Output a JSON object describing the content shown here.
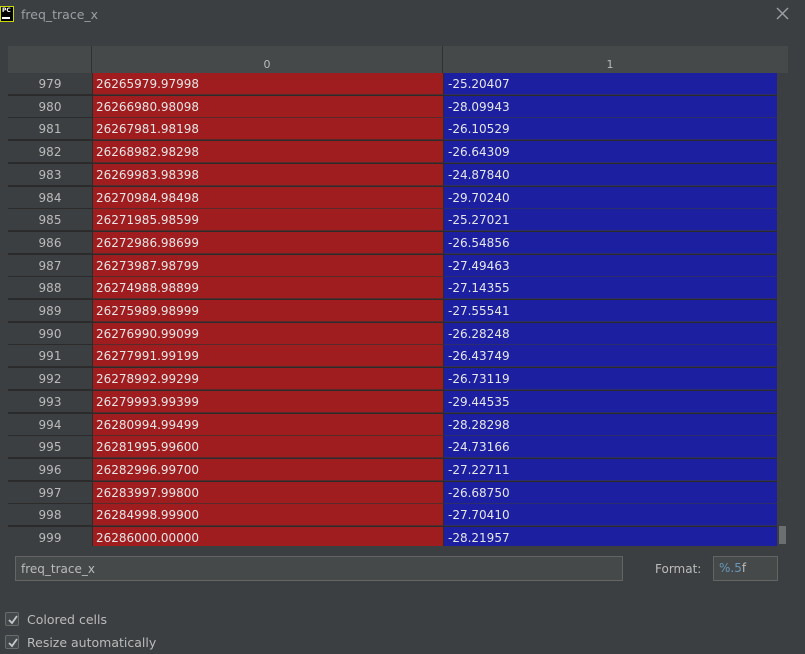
{
  "window": {
    "title": "freq_trace_x",
    "app_icon_text": "PC"
  },
  "table": {
    "columns": [
      "0",
      "1"
    ],
    "rows": [
      {
        "index": "979",
        "c0": "26265979.97998",
        "c1": "-25.20407"
      },
      {
        "index": "980",
        "c0": "26266980.98098",
        "c1": "-28.09943"
      },
      {
        "index": "981",
        "c0": "26267981.98198",
        "c1": "-26.10529"
      },
      {
        "index": "982",
        "c0": "26268982.98298",
        "c1": "-26.64309"
      },
      {
        "index": "983",
        "c0": "26269983.98398",
        "c1": "-24.87840"
      },
      {
        "index": "984",
        "c0": "26270984.98498",
        "c1": "-29.70240"
      },
      {
        "index": "985",
        "c0": "26271985.98599",
        "c1": "-25.27021"
      },
      {
        "index": "986",
        "c0": "26272986.98699",
        "c1": "-26.54856"
      },
      {
        "index": "987",
        "c0": "26273987.98799",
        "c1": "-27.49463"
      },
      {
        "index": "988",
        "c0": "26274988.98899",
        "c1": "-27.14355"
      },
      {
        "index": "989",
        "c0": "26275989.98999",
        "c1": "-27.55541"
      },
      {
        "index": "990",
        "c0": "26276990.99099",
        "c1": "-26.28248"
      },
      {
        "index": "991",
        "c0": "26277991.99199",
        "c1": "-26.43749"
      },
      {
        "index": "992",
        "c0": "26278992.99299",
        "c1": "-26.73119"
      },
      {
        "index": "993",
        "c0": "26279993.99399",
        "c1": "-29.44535"
      },
      {
        "index": "994",
        "c0": "26280994.99499",
        "c1": "-28.28298"
      },
      {
        "index": "995",
        "c0": "26281995.99600",
        "c1": "-24.73166"
      },
      {
        "index": "996",
        "c0": "26282996.99700",
        "c1": "-27.22711"
      },
      {
        "index": "997",
        "c0": "26283997.99800",
        "c1": "-26.68750"
      },
      {
        "index": "998",
        "c0": "26284998.99900",
        "c1": "-27.70410"
      },
      {
        "index": "999",
        "c0": "26286000.00000",
        "c1": "-28.21957"
      }
    ]
  },
  "name_field": {
    "value": "freq_trace_x"
  },
  "format": {
    "label": "Format:",
    "value_prefix": "%",
    "value_num": ".5",
    "value_suffix": "f"
  },
  "options": {
    "colored_cells": {
      "label": "Colored cells",
      "checked": true
    },
    "resize_automatically": {
      "label": "Resize automatically",
      "checked": true
    }
  },
  "colors": {
    "background": "#3c3f41",
    "column0_cell": "#9f1c1f",
    "column1_cell": "#1b1fa0"
  }
}
